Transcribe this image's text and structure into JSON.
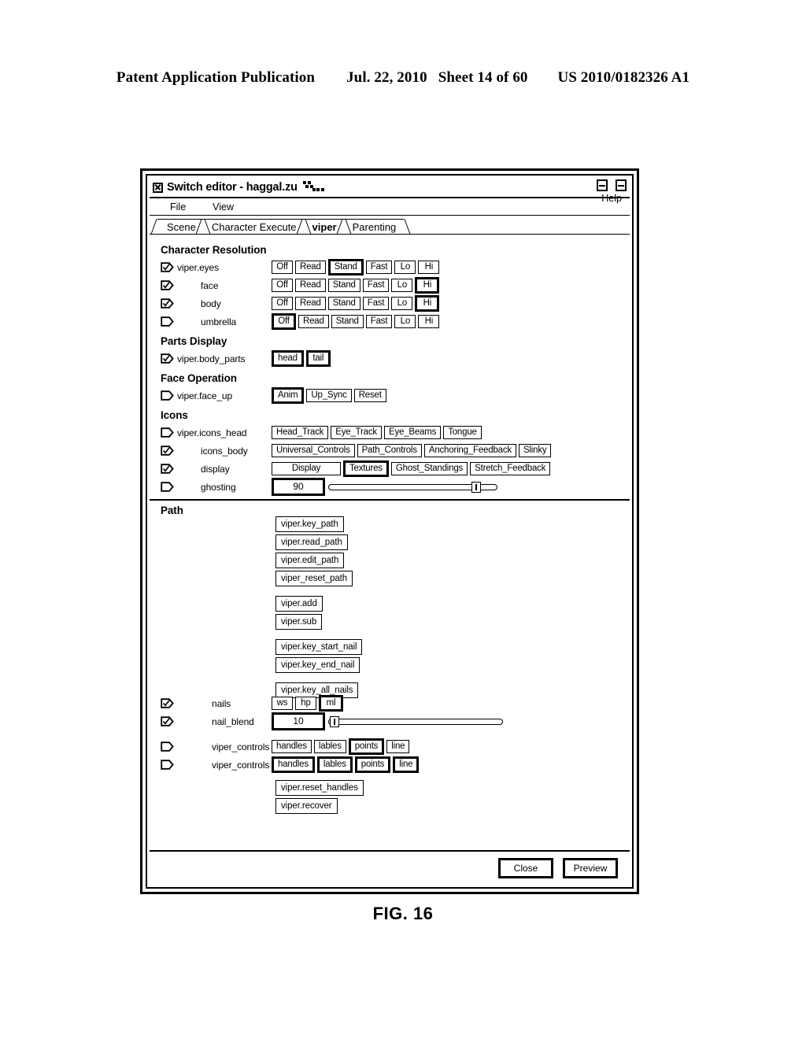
{
  "patent_header": {
    "publication": "Patent Application Publication",
    "date": "Jul. 22, 2010",
    "sheet": "Sheet 14 of 60",
    "number": "US 2010/0182326 A1"
  },
  "figure_caption": "FIG. 16",
  "window": {
    "title": "Switch editor - haggal.zu",
    "sysmenu_icon": "close-box-icon",
    "minimize_icon": "minimize-icon",
    "maximize_icon": "maximize-icon"
  },
  "menubar": {
    "items": [
      {
        "label": "File"
      },
      {
        "label": "View"
      }
    ],
    "help_label": "Help"
  },
  "tabs": [
    {
      "label": "Scene",
      "active": false
    },
    {
      "label": "Character Execute",
      "active": false
    },
    {
      "label": "viper",
      "active": true
    },
    {
      "label": "Parenting",
      "active": false
    }
  ],
  "sections": {
    "character_resolution": {
      "title": "Character Resolution",
      "rows": [
        {
          "checked": true,
          "label": "viper.eyes",
          "indent": 0,
          "options": [
            "Off",
            "Read",
            "Stand",
            "Fast",
            "Lo",
            "Hi"
          ],
          "selected": "Stand"
        },
        {
          "checked": true,
          "label": "face",
          "indent": 1,
          "options": [
            "Off",
            "Read",
            "Stand",
            "Fast",
            "Lo",
            "Hi"
          ],
          "selected": "Hi"
        },
        {
          "checked": true,
          "label": "body",
          "indent": 1,
          "options": [
            "Off",
            "Read",
            "Stand",
            "Fast",
            "Lo",
            "Hi"
          ],
          "selected": "Hi"
        },
        {
          "checked": false,
          "label": "umbrella",
          "indent": 1,
          "options": [
            "Off",
            "Read",
            "Stand",
            "Fast",
            "Lo",
            "Hi"
          ],
          "selected": "Off"
        }
      ]
    },
    "parts_display": {
      "title": "Parts Display",
      "rows": [
        {
          "checked": true,
          "label": "viper.body_parts",
          "indent": 0,
          "options": [
            "head",
            "tail"
          ],
          "selected": "head"
        }
      ]
    },
    "face_operation": {
      "title": "Face Operation",
      "rows": [
        {
          "checked": false,
          "label": "viper.face_up",
          "indent": 0,
          "options": [
            "Anim",
            "Up_Sync",
            "Reset"
          ],
          "selected": "Anim"
        }
      ]
    },
    "icons": {
      "title": "Icons",
      "rows": [
        {
          "checked": false,
          "label": "viper.icons_head",
          "indent": 0,
          "options": [
            "Head_Track",
            "Eye_Track",
            "Eye_Beams",
            "Tongue"
          ],
          "selected": ""
        },
        {
          "checked": true,
          "label": "icons_body",
          "indent": 1,
          "options": [
            "Universal_Controls",
            "Path_Controls",
            "Anchoring_Feedback",
            "Slinky"
          ],
          "selected": ""
        },
        {
          "checked": true,
          "label": "display",
          "indent": 1,
          "options": [
            "Display",
            "Textures",
            "Ghost_Standings",
            "Stretch_Feedback"
          ],
          "selected": "Textures"
        }
      ],
      "ghosting": {
        "checked": false,
        "label": "ghosting",
        "value": "90",
        "slider_percent": 90
      }
    },
    "path": {
      "title": "Path",
      "button_groups": [
        [
          "viper.key_path",
          "viper.read_path",
          "viper.edit_path",
          "viper_reset_path"
        ],
        [
          "viper.add",
          "viper.sub"
        ],
        [
          "viper.key_start_nail",
          "viper.key_end_nail"
        ],
        [
          "viper.key_all_nails"
        ]
      ],
      "nails": {
        "checked": true,
        "label": "nails",
        "options": [
          "ws",
          "hp",
          "ml"
        ],
        "selected": "ml"
      },
      "nail_blend": {
        "checked": true,
        "label": "nail_blend",
        "value": "10",
        "slider_percent": 5
      },
      "controls_rows": [
        {
          "checked": false,
          "label": "viper_controls",
          "options": [
            "handles",
            "lables",
            "points",
            "line"
          ],
          "selected": ""
        },
        {
          "checked": false,
          "label": "viper_controls",
          "options": [
            "handles",
            "lables",
            "points",
            "line"
          ],
          "selected": ""
        }
      ],
      "trailing_buttons": [
        "viper.reset_handles",
        "viper.recover"
      ]
    }
  },
  "footer": {
    "close_label": "Close",
    "preview_label": "Preview"
  }
}
